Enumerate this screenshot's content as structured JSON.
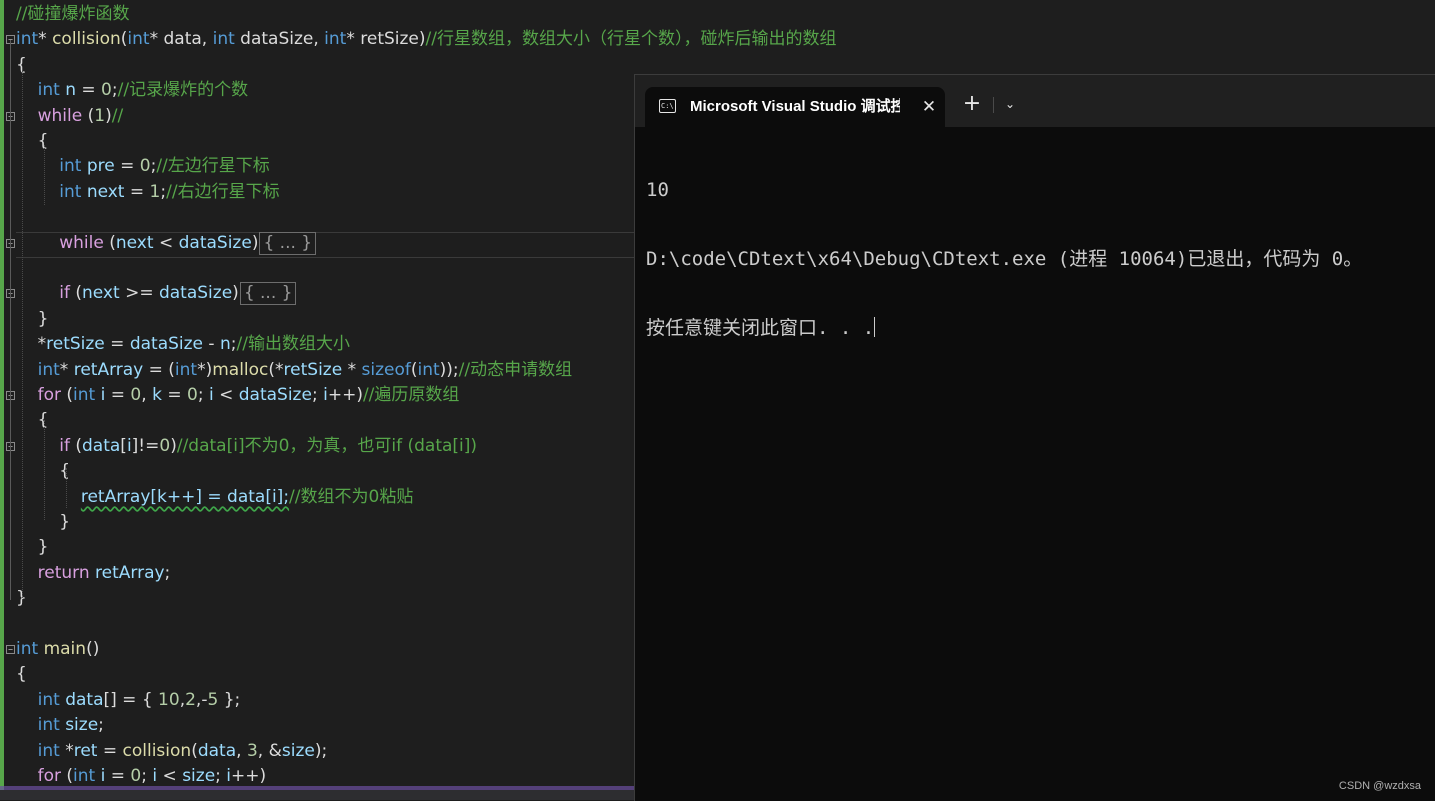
{
  "editor": {
    "lines": [
      [
        [
          "cm",
          "//碰撞爆炸函数"
        ]
      ],
      [
        [
          "kw",
          "int"
        ],
        [
          "ph",
          "* "
        ],
        [
          "fn",
          "collision"
        ],
        [
          "ph",
          "("
        ],
        [
          "kw",
          "int"
        ],
        [
          "ph",
          "* data, "
        ],
        [
          "kw",
          "int"
        ],
        [
          "ph",
          " dataSize, "
        ],
        [
          "kw",
          "int"
        ],
        [
          "ph",
          "* retSize)"
        ],
        [
          "cm",
          "//行星数组，数组大小（行星个数），碰炸后输出的数组"
        ]
      ],
      [
        [
          "ph",
          "{"
        ]
      ],
      [
        [
          "ph",
          "    "
        ],
        [
          "kw",
          "int"
        ],
        [
          "ph",
          " "
        ],
        [
          "var",
          "n"
        ],
        [
          "ph",
          " = "
        ],
        [
          "num",
          "0"
        ],
        [
          "ph",
          ";"
        ],
        [
          "cm",
          "//记录爆炸的个数"
        ]
      ],
      [
        [
          "ph",
          "    "
        ],
        [
          "kw2",
          "while"
        ],
        [
          "ph",
          " ("
        ],
        [
          "num",
          "1"
        ],
        [
          "ph",
          ")"
        ],
        [
          "cm",
          "//"
        ]
      ],
      [
        [
          "ph",
          "    {"
        ]
      ],
      [
        [
          "ph",
          "        "
        ],
        [
          "kw",
          "int"
        ],
        [
          "ph",
          " "
        ],
        [
          "var",
          "pre"
        ],
        [
          "ph",
          " = "
        ],
        [
          "num",
          "0"
        ],
        [
          "ph",
          ";"
        ],
        [
          "cm",
          "//左边行星下标"
        ]
      ],
      [
        [
          "ph",
          "        "
        ],
        [
          "kw",
          "int"
        ],
        [
          "ph",
          " "
        ],
        [
          "var",
          "next"
        ],
        [
          "ph",
          " = "
        ],
        [
          "num",
          "1"
        ],
        [
          "ph",
          ";"
        ],
        [
          "cm",
          "//右边行星下标"
        ]
      ],
      [],
      [
        [
          "ph",
          "        "
        ],
        [
          "kw2",
          "while"
        ],
        [
          "ph",
          " ("
        ],
        [
          "var",
          "next"
        ],
        [
          "ph",
          " < "
        ],
        [
          "var",
          "dataSize"
        ],
        [
          "ph",
          ")"
        ],
        [
          "box",
          "{ ... }"
        ]
      ],
      [],
      [
        [
          "ph",
          "        "
        ],
        [
          "kw2",
          "if"
        ],
        [
          "ph",
          " ("
        ],
        [
          "var",
          "next"
        ],
        [
          "ph",
          " >= "
        ],
        [
          "var",
          "dataSize"
        ],
        [
          "ph",
          ")"
        ],
        [
          "box",
          "{ ... }"
        ]
      ],
      [
        [
          "ph",
          "    }"
        ]
      ],
      [
        [
          "ph",
          "    *"
        ],
        [
          "var",
          "retSize"
        ],
        [
          "ph",
          " = "
        ],
        [
          "var",
          "dataSize"
        ],
        [
          "ph",
          " - "
        ],
        [
          "var",
          "n"
        ],
        [
          "ph",
          ";"
        ],
        [
          "cm",
          "//输出数组大小"
        ]
      ],
      [
        [
          "ph",
          "    "
        ],
        [
          "kw",
          "int"
        ],
        [
          "ph",
          "* "
        ],
        [
          "var",
          "retArray"
        ],
        [
          "ph",
          " = ("
        ],
        [
          "kw",
          "int"
        ],
        [
          "ph",
          "*)"
        ],
        [
          "fn",
          "malloc"
        ],
        [
          "ph",
          "(*"
        ],
        [
          "var",
          "retSize"
        ],
        [
          "ph",
          " * "
        ],
        [
          "kw",
          "sizeof"
        ],
        [
          "ph",
          "("
        ],
        [
          "kw",
          "int"
        ],
        [
          "ph",
          "));"
        ],
        [
          "cm",
          "//动态申请数组"
        ]
      ],
      [
        [
          "ph",
          "    "
        ],
        [
          "kw2",
          "for"
        ],
        [
          "ph",
          " ("
        ],
        [
          "kw",
          "int"
        ],
        [
          "ph",
          " "
        ],
        [
          "var",
          "i"
        ],
        [
          "ph",
          " = "
        ],
        [
          "num",
          "0"
        ],
        [
          "ph",
          ", "
        ],
        [
          "var",
          "k"
        ],
        [
          "ph",
          " = "
        ],
        [
          "num",
          "0"
        ],
        [
          "ph",
          "; "
        ],
        [
          "var",
          "i"
        ],
        [
          "ph",
          " < "
        ],
        [
          "var",
          "dataSize"
        ],
        [
          "ph",
          "; "
        ],
        [
          "var",
          "i"
        ],
        [
          "ph",
          "++)"
        ],
        [
          "cm",
          "//遍历原数组"
        ]
      ],
      [
        [
          "ph",
          "    {"
        ]
      ],
      [
        [
          "ph",
          "        "
        ],
        [
          "kw2",
          "if"
        ],
        [
          "ph",
          " ("
        ],
        [
          "var",
          "data"
        ],
        [
          "ph",
          "["
        ],
        [
          "var",
          "i"
        ],
        [
          "ph",
          "]!="
        ],
        [
          "num",
          "0"
        ],
        [
          "ph",
          ")"
        ],
        [
          "cm",
          "//data[i]不为0，为真，也可if (data[i])"
        ]
      ],
      [
        [
          "ph",
          "        {"
        ]
      ],
      [
        [
          "ph",
          "            "
        ],
        [
          "sq",
          "retArray[k++] = data[i];"
        ],
        [
          "cm",
          "//数组不为0粘贴"
        ]
      ],
      [
        [
          "ph",
          "        }"
        ]
      ],
      [
        [
          "ph",
          "    }"
        ]
      ],
      [
        [
          "ph",
          "    "
        ],
        [
          "kw2",
          "return"
        ],
        [
          "ph",
          " "
        ],
        [
          "var",
          "retArray"
        ],
        [
          "ph",
          ";"
        ]
      ],
      [
        [
          "ph",
          "}"
        ]
      ],
      [],
      [
        [
          "kw",
          "int"
        ],
        [
          "ph",
          " "
        ],
        [
          "fn",
          "main"
        ],
        [
          "ph",
          "()"
        ]
      ],
      [
        [
          "ph",
          "{"
        ]
      ],
      [
        [
          "ph",
          "    "
        ],
        [
          "kw",
          "int"
        ],
        [
          "ph",
          " "
        ],
        [
          "var",
          "data"
        ],
        [
          "ph",
          "[] = { "
        ],
        [
          "num",
          "10"
        ],
        [
          "ph",
          ","
        ],
        [
          "num",
          "2"
        ],
        [
          "ph",
          ",-"
        ],
        [
          "num",
          "5"
        ],
        [
          "ph",
          " };"
        ]
      ],
      [
        [
          "ph",
          "    "
        ],
        [
          "kw",
          "int"
        ],
        [
          "ph",
          " "
        ],
        [
          "var",
          "size"
        ],
        [
          "ph",
          ";"
        ]
      ],
      [
        [
          "ph",
          "    "
        ],
        [
          "kw",
          "int"
        ],
        [
          "ph",
          " *"
        ],
        [
          "var",
          "ret"
        ],
        [
          "ph",
          " = "
        ],
        [
          "fn",
          "collision"
        ],
        [
          "ph",
          "("
        ],
        [
          "var",
          "data"
        ],
        [
          "ph",
          ", "
        ],
        [
          "num",
          "3"
        ],
        [
          "ph",
          ", &"
        ],
        [
          "var",
          "size"
        ],
        [
          "ph",
          ");"
        ]
      ],
      [
        [
          "ph",
          "    "
        ],
        [
          "kw2",
          "for"
        ],
        [
          "ph",
          " ("
        ],
        [
          "kw",
          "int"
        ],
        [
          "ph",
          " "
        ],
        [
          "var",
          "i"
        ],
        [
          "ph",
          " = "
        ],
        [
          "num",
          "0"
        ],
        [
          "ph",
          "; "
        ],
        [
          "var",
          "i"
        ],
        [
          "ph",
          " < "
        ],
        [
          "var",
          "size"
        ],
        [
          "ph",
          "; "
        ],
        [
          "var",
          "i"
        ],
        [
          "ph",
          "++)"
        ]
      ]
    ]
  },
  "terminal": {
    "tab_title": "Microsoft Visual Studio 调试控",
    "tab_icon_text": "C:\\",
    "close_glyph": "✕",
    "new_tab_glyph": "+",
    "dropdown_glyph": "⌄",
    "output": [
      "10",
      "D:\\code\\CDtext\\x64\\Debug\\CDtext.exe (进程 10064)已退出，代码为 0。",
      "按任意键关闭此窗口. . ."
    ]
  },
  "watermark": "CSDN @wzdxsa",
  "colors": {
    "keyword": "#569cd6",
    "control": "#d8a0df",
    "function": "#dcdcaa",
    "variable": "#9cdcfe",
    "number": "#b5cea8",
    "comment": "#57a64a",
    "terminal_bg": "#0c0c0c",
    "editor_bg": "#1e1e1e"
  }
}
